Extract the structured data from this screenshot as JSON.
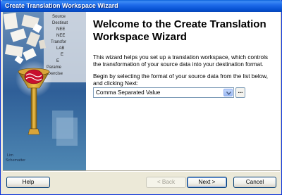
{
  "window": {
    "title": "Create Translation Workspace Wizard"
  },
  "main": {
    "heading": "Welcome to the Create Translation Workspace Wizard",
    "intro": "This wizard helps you set up a translation workspace, which controls the transformation of your source data into your destination format.",
    "instruction": "Begin by selecting the format of your source data from the list below, and clicking Next:",
    "format_select": {
      "value": "Comma Separated Value"
    },
    "browse_label": "..."
  },
  "buttons": {
    "help": "Help",
    "back": "< Back",
    "next": "Next >",
    "cancel": "Cancel"
  },
  "art": {
    "tree_labels": [
      "Source",
      "Destinat",
      "NEE",
      "NEE",
      "Transfor",
      "LAB",
      "E",
      "Parame",
      "Exercise",
      "Exercise"
    ],
    "footer_labels": [
      "Lim",
      "Schematter"
    ]
  },
  "colors": {
    "titlebar": "#0a5fd8",
    "accent": "#003c74"
  }
}
